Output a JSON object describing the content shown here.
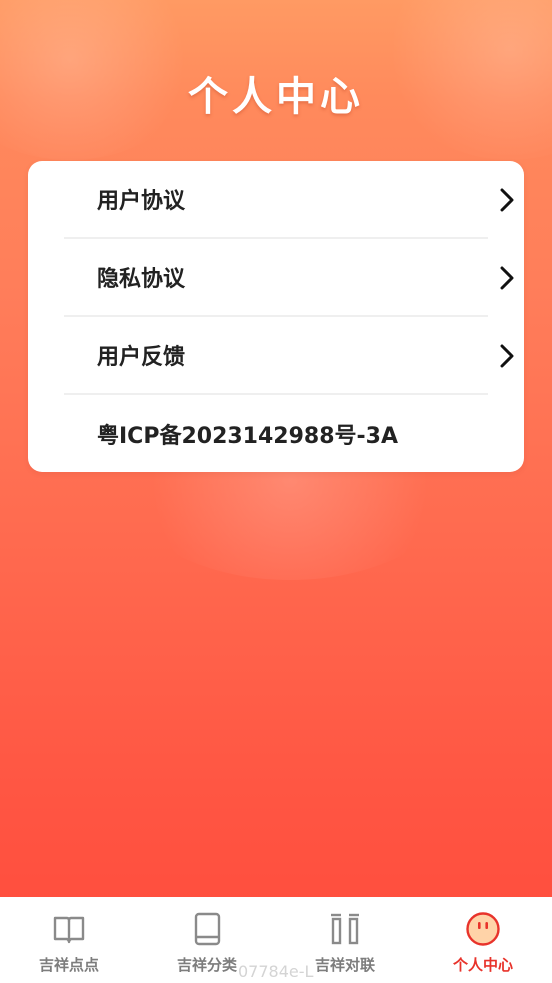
{
  "header": {
    "title": "个人中心"
  },
  "menu": {
    "items": [
      {
        "label": "用户协议",
        "has_chevron": true
      },
      {
        "label": "隐私协议",
        "has_chevron": true
      },
      {
        "label": "用户反馈",
        "has_chevron": true
      },
      {
        "label": "粤ICP备2023142988号-3A",
        "has_chevron": false
      }
    ]
  },
  "tabbar": {
    "tabs": [
      {
        "label": "吉祥点点",
        "icon": "book-open-icon",
        "active": false
      },
      {
        "label": "吉祥分类",
        "icon": "book-icon",
        "active": false
      },
      {
        "label": "吉祥对联",
        "icon": "couplet-icon",
        "active": false
      },
      {
        "label": "个人中心",
        "icon": "smiley-face-icon",
        "active": true
      }
    ]
  },
  "watermark": "07784e-L",
  "colors": {
    "accent": "#e8332b",
    "inactive": "#7d7d7d",
    "gradient_top": "#ff9a63",
    "gradient_bottom": "#ff4a3b"
  }
}
